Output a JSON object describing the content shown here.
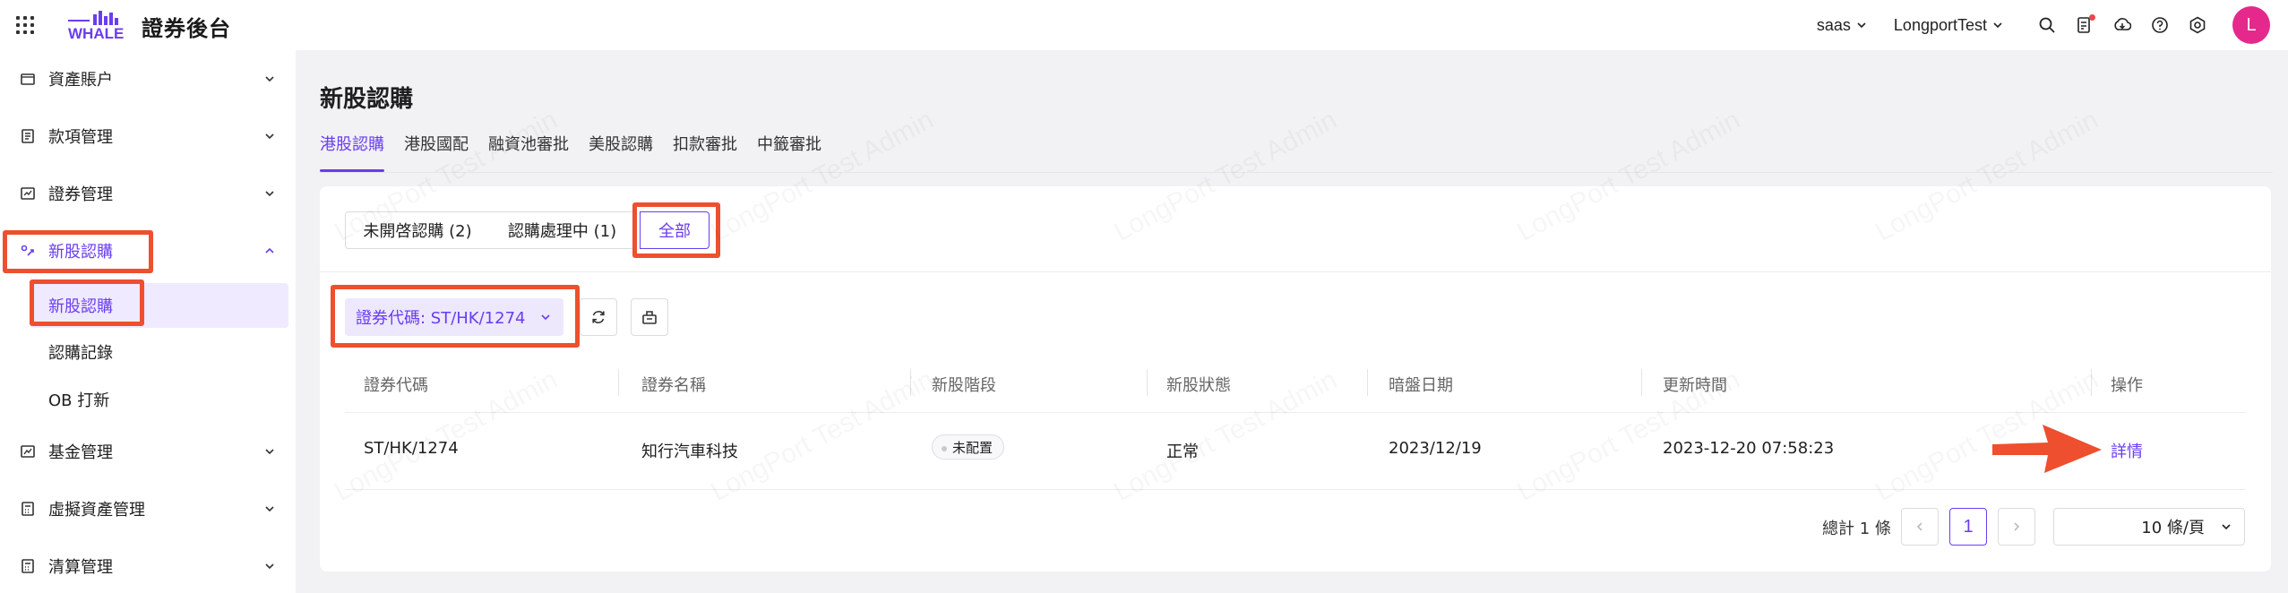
{
  "app": {
    "logo_text": "WHALE",
    "title": "證券後台"
  },
  "topbar": {
    "tenant": "saas",
    "account": "LongportTest",
    "avatar_letter": "L",
    "icons": [
      "search-icon",
      "document-notification-icon",
      "download-icon",
      "help-icon",
      "settings-icon"
    ]
  },
  "sidebar": {
    "items": [
      {
        "label": "資產賬户",
        "icon": "wallet-icon"
      },
      {
        "label": "款項管理",
        "icon": "ledger-icon"
      },
      {
        "label": "證券管理",
        "icon": "chart-card-icon"
      },
      {
        "label": "新股認購",
        "icon": "ipo-icon"
      },
      {
        "label": "基金管理",
        "icon": "trend-chart-icon"
      },
      {
        "label": "虛擬資產管理",
        "icon": "calculator-icon"
      },
      {
        "label": "清算管理",
        "icon": "calculator-icon"
      }
    ],
    "sub_items": [
      {
        "label": "新股認購"
      },
      {
        "label": "認購記錄"
      },
      {
        "label": "OB 打新"
      }
    ]
  },
  "main": {
    "title": "新股認購",
    "tabs": [
      {
        "label": "港股認購"
      },
      {
        "label": "港股國配"
      },
      {
        "label": "融資池審批"
      },
      {
        "label": "美股認購"
      },
      {
        "label": "扣款審批"
      },
      {
        "label": "中籤審批"
      }
    ],
    "segments": [
      {
        "label": "未開啓認購 (2)"
      },
      {
        "label": "認購處理中 (1)"
      },
      {
        "label": "全部"
      }
    ],
    "filter": {
      "label": "證券代碼: ST/HK/1274"
    },
    "table": {
      "columns": [
        "證券代碼",
        "證券名稱",
        "新股階段",
        "新股狀態",
        "暗盤日期",
        "更新時間",
        "操作"
      ],
      "rows": [
        {
          "code": "ST/HK/1274",
          "name": "知行汽車科技",
          "stage": "未配置",
          "status": "正常",
          "grey_market_date": "2023/12/19",
          "updated_at": "2023-12-20 07:58:23",
          "action": "詳情"
        }
      ]
    },
    "pagination": {
      "total": "總計 1 條",
      "current_page": "1",
      "page_size": "10 條/頁"
    }
  },
  "watermark": "LongPort Test Admin",
  "colors": {
    "accent": "#6a3df0",
    "highlight": "#ee4f2f",
    "avatar": "#e5288b"
  }
}
